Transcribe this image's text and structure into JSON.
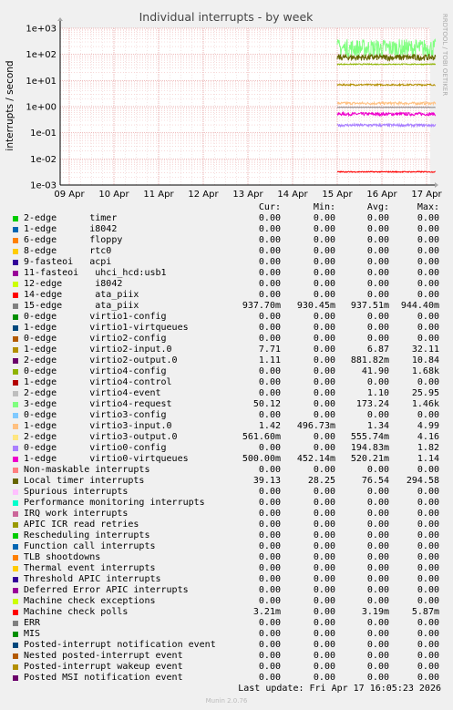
{
  "chart_data": {
    "type": "line",
    "title": "Individual interrupts - by week",
    "ylabel": "interrupts / second",
    "yscale": "log",
    "ylim": [
      0.001,
      1000
    ],
    "y_ticks": [
      "1e-03",
      "1e-02",
      "1e-01",
      "1e+00",
      "1e+01",
      "1e+02",
      "1e+03"
    ],
    "x_ticks": [
      "09 Apr",
      "10 Apr",
      "11 Apr",
      "12 Apr",
      "13 Apr",
      "14 Apr",
      "15 Apr",
      "16 Apr",
      "17 Apr"
    ],
    "x_range_days": [
      "2026-04-09",
      "2026-04-17"
    ],
    "data_start": "2026-04-15",
    "grid": true,
    "side_label": "RRDTOOL / TOBI OETIKER",
    "series": [
      {
        "name": "15-edge ata_piix",
        "values": {
          "avg": 0.93751
        }
      },
      {
        "name": "1-edge virtio0-virtqueues",
        "values": {
          "avg": 0.52021
        }
      },
      {
        "name": "1-edge virtio3-input.0",
        "values": {
          "avg": 1.34
        }
      },
      {
        "name": "1-edge virtio2-input.0",
        "values": {
          "avg": 6.87
        }
      },
      {
        "name": "3-edge virtio4-request",
        "values": {
          "avg": 173.24
        }
      },
      {
        "name": "Local timer interrupts",
        "values": {
          "avg": 76.54
        }
      },
      {
        "name": "0-edge virtio4-config",
        "values": {
          "avg": 41.9
        }
      },
      {
        "name": "0-edge virtio0-config",
        "values": {
          "avg": 0.19483
        }
      },
      {
        "name": "Machine check polls",
        "values": {
          "avg": 0.00319
        }
      }
    ]
  },
  "legend": {
    "headers": [
      "Cur:",
      "Min:",
      "Avg:",
      "Max:"
    ],
    "rows": [
      {
        "label": "2-edge      timer",
        "color": "#00cc00",
        "cur": "0.00",
        "min": "0.00",
        "avg": "0.00",
        "max": "0.00"
      },
      {
        "label": "1-edge      i8042",
        "color": "#0066b3",
        "cur": "0.00",
        "min": "0.00",
        "avg": "0.00",
        "max": "0.00"
      },
      {
        "label": "6-edge      floppy",
        "color": "#ff8000",
        "cur": "0.00",
        "min": "0.00",
        "avg": "0.00",
        "max": "0.00"
      },
      {
        "label": "8-edge      rtc0",
        "color": "#ffcc00",
        "cur": "0.00",
        "min": "0.00",
        "avg": "0.00",
        "max": "0.00"
      },
      {
        "label": "9-fasteoi   acpi",
        "color": "#330099",
        "cur": "0.00",
        "min": "0.00",
        "avg": "0.00",
        "max": "0.00"
      },
      {
        "label": "11-fasteoi   uhci_hcd:usb1",
        "color": "#990099",
        "cur": "0.00",
        "min": "0.00",
        "avg": "0.00",
        "max": "0.00"
      },
      {
        "label": "12-edge      i8042",
        "color": "#ccff00",
        "cur": "0.00",
        "min": "0.00",
        "avg": "0.00",
        "max": "0.00"
      },
      {
        "label": "14-edge      ata_piix",
        "color": "#ff0000",
        "cur": "0.00",
        "min": "0.00",
        "avg": "0.00",
        "max": "0.00"
      },
      {
        "label": "15-edge      ata_piix",
        "color": "#808080",
        "cur": "937.70m",
        "min": "930.45m",
        "avg": "937.51m",
        "max": "944.40m"
      },
      {
        "label": "0-edge      virtio1-config",
        "color": "#008f00",
        "cur": "0.00",
        "min": "0.00",
        "avg": "0.00",
        "max": "0.00"
      },
      {
        "label": "1-edge      virtio1-virtqueues",
        "color": "#00487d",
        "cur": "0.00",
        "min": "0.00",
        "avg": "0.00",
        "max": "0.00"
      },
      {
        "label": "0-edge      virtio2-config",
        "color": "#b35a00",
        "cur": "0.00",
        "min": "0.00",
        "avg": "0.00",
        "max": "0.00"
      },
      {
        "label": "1-edge      virtio2-input.0",
        "color": "#b38f00",
        "cur": "7.71",
        "min": "0.00",
        "avg": "6.87",
        "max": "32.11"
      },
      {
        "label": "2-edge      virtio2-output.0",
        "color": "#6b006b",
        "cur": "1.11",
        "min": "0.00",
        "avg": "881.82m",
        "max": "10.84"
      },
      {
        "label": "0-edge      virtio4-config",
        "color": "#8fb300",
        "cur": "0.00",
        "min": "0.00",
        "avg": "41.90",
        "max": "1.68k"
      },
      {
        "label": "1-edge      virtio4-control",
        "color": "#b30000",
        "cur": "0.00",
        "min": "0.00",
        "avg": "0.00",
        "max": "0.00"
      },
      {
        "label": "2-edge      virtio4-event",
        "color": "#bebebe",
        "cur": "0.00",
        "min": "0.00",
        "avg": "1.10",
        "max": "25.95"
      },
      {
        "label": "3-edge      virtio4-request",
        "color": "#80ff80",
        "cur": "50.12",
        "min": "0.00",
        "avg": "173.24",
        "max": "1.46k"
      },
      {
        "label": "0-edge      virtio3-config",
        "color": "#80c9ff",
        "cur": "0.00",
        "min": "0.00",
        "avg": "0.00",
        "max": "0.00"
      },
      {
        "label": "1-edge      virtio3-input.0",
        "color": "#ffc080",
        "cur": "1.42",
        "min": "496.73m",
        "avg": "1.34",
        "max": "4.99"
      },
      {
        "label": "2-edge      virtio3-output.0",
        "color": "#ffe680",
        "cur": "561.60m",
        "min": "0.00",
        "avg": "555.74m",
        "max": "4.16"
      },
      {
        "label": "0-edge      virtio0-config",
        "color": "#aa80ff",
        "cur": "0.00",
        "min": "0.00",
        "avg": "194.83m",
        "max": "1.82"
      },
      {
        "label": "1-edge      virtio0-virtqueues",
        "color": "#ee00cc",
        "cur": "500.00m",
        "min": "452.14m",
        "avg": "520.21m",
        "max": "1.14"
      },
      {
        "label": "Non-maskable interrupts",
        "color": "#ff8080",
        "cur": "0.00",
        "min": "0.00",
        "avg": "0.00",
        "max": "0.00"
      },
      {
        "label": "Local timer interrupts",
        "color": "#666600",
        "cur": "39.13",
        "min": "28.25",
        "avg": "76.54",
        "max": "294.58"
      },
      {
        "label": "Spurious interrupts",
        "color": "#ffbfff",
        "cur": "0.00",
        "min": "0.00",
        "avg": "0.00",
        "max": "0.00"
      },
      {
        "label": "Performance monitoring interrupts",
        "color": "#00ffcc",
        "cur": "0.00",
        "min": "0.00",
        "avg": "0.00",
        "max": "0.00"
      },
      {
        "label": "IRQ work interrupts",
        "color": "#cc6699",
        "cur": "0.00",
        "min": "0.00",
        "avg": "0.00",
        "max": "0.00"
      },
      {
        "label": "APIC ICR read retries",
        "color": "#999900",
        "cur": "0.00",
        "min": "0.00",
        "avg": "0.00",
        "max": "0.00"
      },
      {
        "label": "Rescheduling interrupts",
        "color": "#00cc00",
        "cur": "0.00",
        "min": "0.00",
        "avg": "0.00",
        "max": "0.00"
      },
      {
        "label": "Function call interrupts",
        "color": "#0066b3",
        "cur": "0.00",
        "min": "0.00",
        "avg": "0.00",
        "max": "0.00"
      },
      {
        "label": "TLB shootdowns",
        "color": "#ff8000",
        "cur": "0.00",
        "min": "0.00",
        "avg": "0.00",
        "max": "0.00"
      },
      {
        "label": "Thermal event interrupts",
        "color": "#ffcc00",
        "cur": "0.00",
        "min": "0.00",
        "avg": "0.00",
        "max": "0.00"
      },
      {
        "label": "Threshold APIC interrupts",
        "color": "#330099",
        "cur": "0.00",
        "min": "0.00",
        "avg": "0.00",
        "max": "0.00"
      },
      {
        "label": "Deferred Error APIC interrupts",
        "color": "#990099",
        "cur": "0.00",
        "min": "0.00",
        "avg": "0.00",
        "max": "0.00"
      },
      {
        "label": "Machine check exceptions",
        "color": "#ccff00",
        "cur": "0.00",
        "min": "0.00",
        "avg": "0.00",
        "max": "0.00"
      },
      {
        "label": "Machine check polls",
        "color": "#ff0000",
        "cur": "3.21m",
        "min": "0.00",
        "avg": "3.19m",
        "max": "5.87m"
      },
      {
        "label": "ERR",
        "color": "#808080",
        "cur": "0.00",
        "min": "0.00",
        "avg": "0.00",
        "max": "0.00"
      },
      {
        "label": "MIS",
        "color": "#008f00",
        "cur": "0.00",
        "min": "0.00",
        "avg": "0.00",
        "max": "0.00"
      },
      {
        "label": "Posted-interrupt notification event",
        "color": "#00487d",
        "cur": "0.00",
        "min": "0.00",
        "avg": "0.00",
        "max": "0.00"
      },
      {
        "label": "Nested posted-interrupt event",
        "color": "#b35a00",
        "cur": "0.00",
        "min": "0.00",
        "avg": "0.00",
        "max": "0.00"
      },
      {
        "label": "Posted-interrupt wakeup event",
        "color": "#b38f00",
        "cur": "0.00",
        "min": "0.00",
        "avg": "0.00",
        "max": "0.00"
      },
      {
        "label": "Posted MSI notification event",
        "color": "#6b006b",
        "cur": "0.00",
        "min": "0.00",
        "avg": "0.00",
        "max": "0.00"
      }
    ]
  },
  "last_update": "Last update: Fri Apr 17 16:05:23 2026",
  "footer": "Munin 2.0.76"
}
